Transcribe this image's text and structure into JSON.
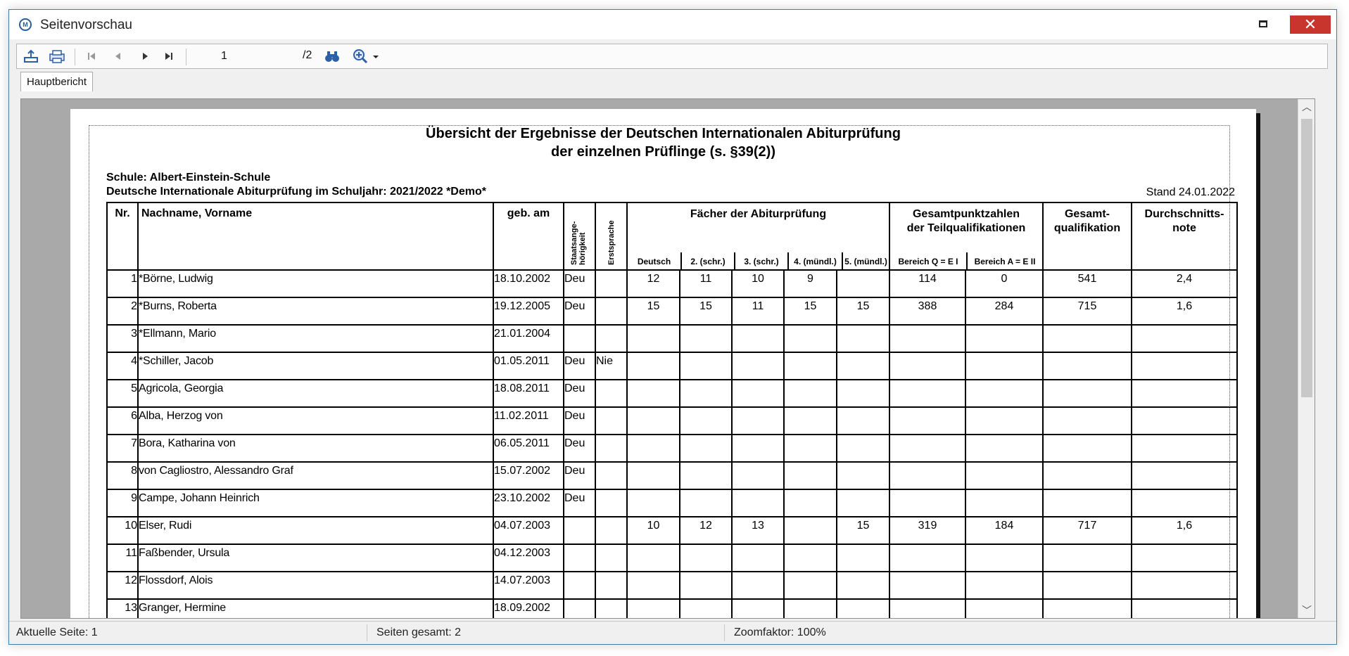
{
  "window": {
    "title": "Seitenvorschau",
    "close_symbol": "✕"
  },
  "toolbar": {
    "page_value": "1",
    "page_total": "/2",
    "icons": [
      "export-icon",
      "print-icon",
      "first-page-icon",
      "previous-page-icon",
      "next-page-icon",
      "last-page-icon",
      "binoculars-search-icon",
      "zoom-icon",
      "dropdown-arrow-icon"
    ]
  },
  "tabs": [
    {
      "label": "Hauptbericht"
    }
  ],
  "report": {
    "title_line1": "Übersicht der Ergebnisse der Deutschen Internationalen Abiturprüfung",
    "title_line2": "der einzelnen Prüflinge (s. §39(2))",
    "schule": "Schule: Albert-Einstein-Schule",
    "jahr": "Deutsche Internationale Abiturprüfung im Schuljahr: 2021/2022 *Demo*",
    "stand": "Stand 24.01.2022",
    "headers": {
      "nr": "Nr.",
      "name": "Nachname, Vorname",
      "geb": "geb. am",
      "staat_a": "Staatsange-",
      "staat_b": "hörigkeit",
      "erstsprache": "Erstsprache",
      "faecher": "Fächer der Abiturprüfung",
      "gesamtpunkte_a": "Gesamtpunktzahlen",
      "gesamtpunkte_b": "der Teilqualifikationen",
      "gesamtqual_a": "Gesamt-",
      "gesamtqual_b": "qualifikation",
      "schnitt_a": "Durchschnitts-",
      "schnitt_b": "note",
      "sub_deutsch": "Deutsch",
      "sub_2": "2. (schr.)",
      "sub_3": "3. (schr.)",
      "sub_4": "4. (mündl.)",
      "sub_5": "5. (mündl.)",
      "sub_q": "Bereich Q = E I",
      "sub_a": "Bereich A = E II"
    },
    "rows": [
      {
        "nr": "1",
        "name": "*Börne, Ludwig",
        "geb": "18.10.2002",
        "staat": "Deu",
        "erst": "",
        "d": "12",
        "s2": "11",
        "s3": "10",
        "m4": "9",
        "m5": "",
        "q": "114",
        "a": "0",
        "gq": "541",
        "note": "2,4"
      },
      {
        "nr": "2",
        "name": "*Burns, Roberta",
        "geb": "19.12.2005",
        "staat": "Deu",
        "erst": "",
        "d": "15",
        "s2": "15",
        "s3": "11",
        "m4": "15",
        "m5": "15",
        "q": "388",
        "a": "284",
        "gq": "715",
        "note": "1,6"
      },
      {
        "nr": "3",
        "name": "*Ellmann, Mario",
        "geb": "21.01.2004",
        "staat": "",
        "erst": "",
        "d": "",
        "s2": "",
        "s3": "",
        "m4": "",
        "m5": "",
        "q": "",
        "a": "",
        "gq": "",
        "note": ""
      },
      {
        "nr": "4",
        "name": "*Schiller, Jacob",
        "geb": "01.05.2011",
        "staat": "Deu",
        "erst": "Nie",
        "d": "",
        "s2": "",
        "s3": "",
        "m4": "",
        "m5": "",
        "q": "",
        "a": "",
        "gq": "",
        "note": ""
      },
      {
        "nr": "5",
        "name": "Agricola, Georgia",
        "geb": "18.08.2011",
        "staat": "Deu",
        "erst": "",
        "d": "",
        "s2": "",
        "s3": "",
        "m4": "",
        "m5": "",
        "q": "",
        "a": "",
        "gq": "",
        "note": ""
      },
      {
        "nr": "6",
        "name": "Alba, Herzog von",
        "geb": "11.02.2011",
        "staat": "Deu",
        "erst": "",
        "d": "",
        "s2": "",
        "s3": "",
        "m4": "",
        "m5": "",
        "q": "",
        "a": "",
        "gq": "",
        "note": ""
      },
      {
        "nr": "7",
        "name": "Bora, Katharina von",
        "geb": "06.05.2011",
        "staat": "Deu",
        "erst": "",
        "d": "",
        "s2": "",
        "s3": "",
        "m4": "",
        "m5": "",
        "q": "",
        "a": "",
        "gq": "",
        "note": ""
      },
      {
        "nr": "8",
        "name": "von Cagliostro, Alessandro Graf",
        "geb": "15.07.2002",
        "staat": "Deu",
        "erst": "",
        "d": "",
        "s2": "",
        "s3": "",
        "m4": "",
        "m5": "",
        "q": "",
        "a": "",
        "gq": "",
        "note": ""
      },
      {
        "nr": "9",
        "name": "Campe, Johann Heinrich",
        "geb": "23.10.2002",
        "staat": "Deu",
        "erst": "",
        "d": "",
        "s2": "",
        "s3": "",
        "m4": "",
        "m5": "",
        "q": "",
        "a": "",
        "gq": "",
        "note": ""
      },
      {
        "nr": "10",
        "name": "Elser, Rudi",
        "geb": "04.07.2003",
        "staat": "",
        "erst": "",
        "d": "10",
        "s2": "12",
        "s3": "13",
        "m4": "",
        "m5": "15",
        "q": "319",
        "a": "184",
        "gq": "717",
        "note": "1,6"
      },
      {
        "nr": "11",
        "name": "Faßbender, Ursula",
        "geb": "04.12.2003",
        "staat": "",
        "erst": "",
        "d": "",
        "s2": "",
        "s3": "",
        "m4": "",
        "m5": "",
        "q": "",
        "a": "",
        "gq": "",
        "note": ""
      },
      {
        "nr": "12",
        "name": "Flossdorf, Alois",
        "geb": "14.07.2003",
        "staat": "",
        "erst": "",
        "d": "",
        "s2": "",
        "s3": "",
        "m4": "",
        "m5": "",
        "q": "",
        "a": "",
        "gq": "",
        "note": ""
      },
      {
        "nr": "13",
        "name": "Granger, Hermine",
        "geb": "18.09.2002",
        "staat": "",
        "erst": "",
        "d": "",
        "s2": "",
        "s3": "",
        "m4": "",
        "m5": "",
        "q": "",
        "a": "",
        "gq": "",
        "note": ""
      }
    ]
  },
  "statusbar": {
    "current_page": "Aktuelle Seite: 1",
    "total_pages": "Seiten gesamt: 2",
    "zoom": "Zoomfaktor: 100%"
  }
}
